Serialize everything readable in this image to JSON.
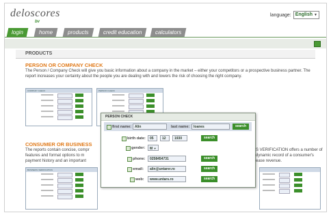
{
  "header": {
    "logo_text": "deloscores",
    "logo_sub": "bv",
    "language_label": "language:",
    "language_value": "English"
  },
  "nav": {
    "tabs": [
      "login",
      "home",
      "products",
      "credit education",
      "calculators"
    ]
  },
  "section": {
    "products_title": "PRODUCTS"
  },
  "person_check": {
    "title": "PERSON OR COMPANY CHECK",
    "text": "The Person / Company Check will give you basic information about a company in the market – either your competitors or a prospective business partner. The report increases your certainty about the people you are dealing with and lowers the risk of choosing the right company.",
    "mini1_title": "COMPANY CHECK",
    "mini2_title": "PERSON CHECK"
  },
  "consumer": {
    "title": "CONSUMER OR BUSINESS",
    "text_left": "The reports contain concise, compr",
    "text_left2": "features and format options to m",
    "text_left3": "payment history and an important",
    "text_right": "S VERIFICATION offers a number of",
    "text_right2": "dynamic record of a consumer's",
    "text_right3": "ease revenue.",
    "mini_title": "BUSINESS VERIFICATION"
  },
  "popup": {
    "title": "PERSON CHECK",
    "first_name_label": "first name:",
    "first_name_value": "Alin",
    "last_name_label": "last name:",
    "last_name_value": "Ioanes",
    "birth_label": "birth date:",
    "birth_day": "05",
    "birth_month": "12",
    "birth_year": "1930",
    "gender_label": "gender:",
    "gender_value": "M",
    "phone_label": "phone:",
    "phone_value": "0258454731",
    "email_label": "email:",
    "email_value": "alin@untarer.ro",
    "web_label": "web:",
    "web_value": "www.untars.ro",
    "search_label": "search"
  }
}
